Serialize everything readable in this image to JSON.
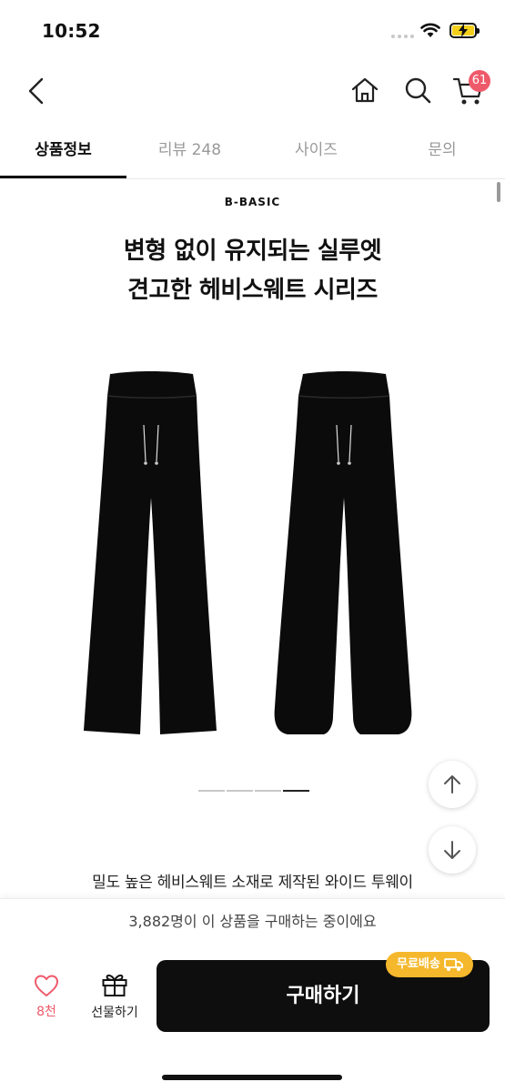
{
  "status_bar": {
    "time": "10:52"
  },
  "nav": {
    "cart_count": "61"
  },
  "tabs": [
    {
      "label": "상품정보",
      "active": true
    },
    {
      "label": "리뷰 248",
      "active": false
    },
    {
      "label": "사이즈",
      "active": false
    },
    {
      "label": "문의",
      "active": false
    }
  ],
  "content": {
    "brand": "B-BASIC",
    "headline_line1": "변형 없이 유지되는 실루엣",
    "headline_line2": "견고한 헤비스웨트 시리즈",
    "carousel_active_index": 3,
    "carousel_count": 4,
    "description": "밀도 높은  헤비스웨트  소재로 제작된 와이드 투웨이"
  },
  "social_proof": "3,882명이 이 상품을 구매하는 중이에요",
  "bottom_bar": {
    "like_count": "8천",
    "gift_label": "선물하기",
    "buy_label": "구매하기",
    "free_shipping_label": "무료배송"
  },
  "colors": {
    "accent_pink": "#ee5a6a",
    "shipping_badge": "#f5b82c",
    "buy_button": "#0e0e0e"
  }
}
